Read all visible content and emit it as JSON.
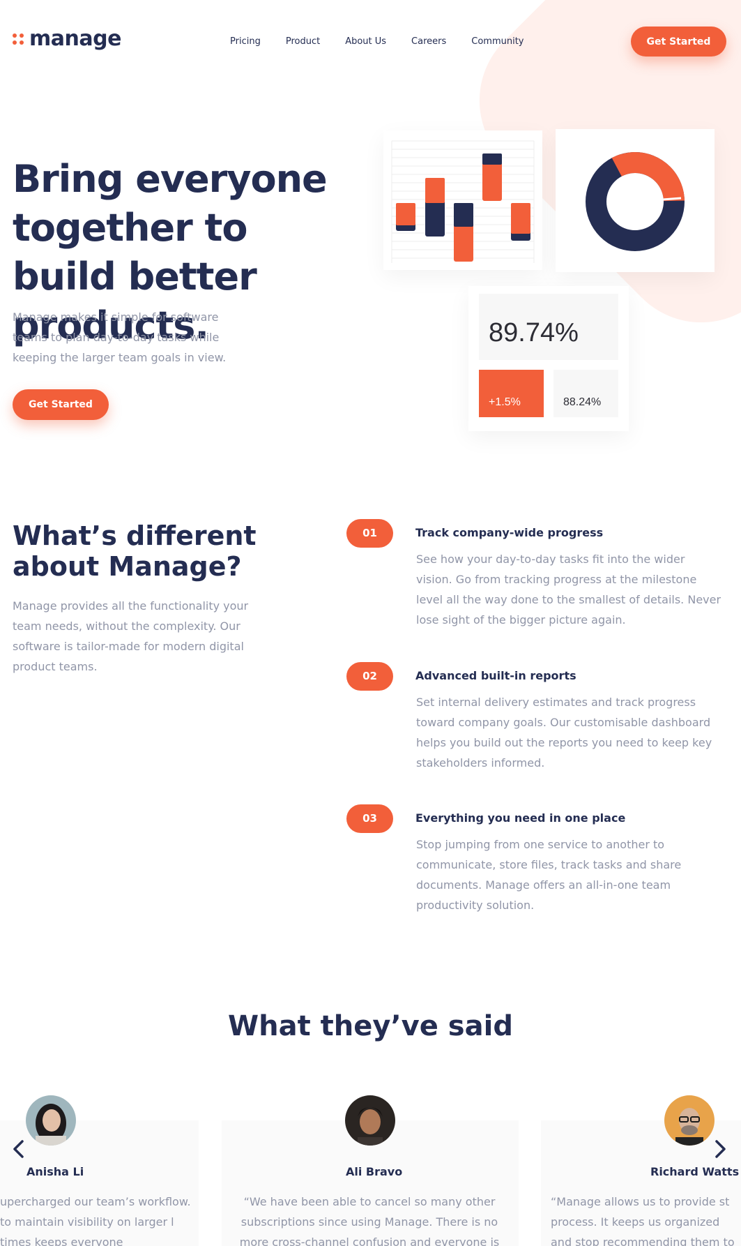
{
  "header": {
    "logo_text": "manage",
    "nav": [
      "Pricing",
      "Product",
      "About Us",
      "Careers",
      "Community"
    ],
    "cta_label": "Get Started"
  },
  "hero": {
    "title": "Bring everyone together to build better products.",
    "text": "Manage makes it simple for software teams to plan day-to-day tasks while keeping the larger team goals in view.",
    "cta_label": "Get Started",
    "stats": {
      "main": "89.74%",
      "change": "+1.5%",
      "secondary": "88.24%"
    }
  },
  "features": {
    "title": "What’s different about Manage?",
    "text": "Manage provides all the functionality your team needs, without the complexity. Our software is tailor-made for modern digital product teams.",
    "items": [
      {
        "num": "01",
        "heading": "Track company-wide progress",
        "body": "See how your day-to-day tasks fit into the wider vision. Go from tracking progress at the milestone level all the way done to the smallest of details. Never lose sight of the bigger picture again."
      },
      {
        "num": "02",
        "heading": "Advanced built-in reports",
        "body": "Set internal delivery estimates and track progress toward company goals. Our customisable dashboard helps you build out the reports you need to keep key stakeholders informed."
      },
      {
        "num": "03",
        "heading": "Everything you need in one place",
        "body": "Stop jumping from one service to another to communicate, store files, track tasks and share documents. Manage offers an all-in-one team productivity solution."
      }
    ]
  },
  "testimonials": {
    "title": "What they’ve said",
    "items": [
      {
        "name": "Anisha Li",
        "quote": "upercharged our team’s workflow. to maintain visibility on larger l times keeps everyone motivated.”"
      },
      {
        "name": "Ali Bravo",
        "quote": "“We have been able to cancel so many other subscriptions since using Manage. There is no more cross-channel confusion and everyone is much"
      },
      {
        "name": "Richard Watts",
        "quote": "“Manage allows us to provide st process. It keeps us organized and stop recommending them to ever"
      }
    ]
  },
  "icons": [
    "logo-dots-icon",
    "chevron-left-icon",
    "chevron-right-icon"
  ],
  "colors": {
    "accent": "#f25f3a",
    "navy": "#242d52",
    "muted": "#9095a7",
    "peach": "#fff0ec"
  }
}
